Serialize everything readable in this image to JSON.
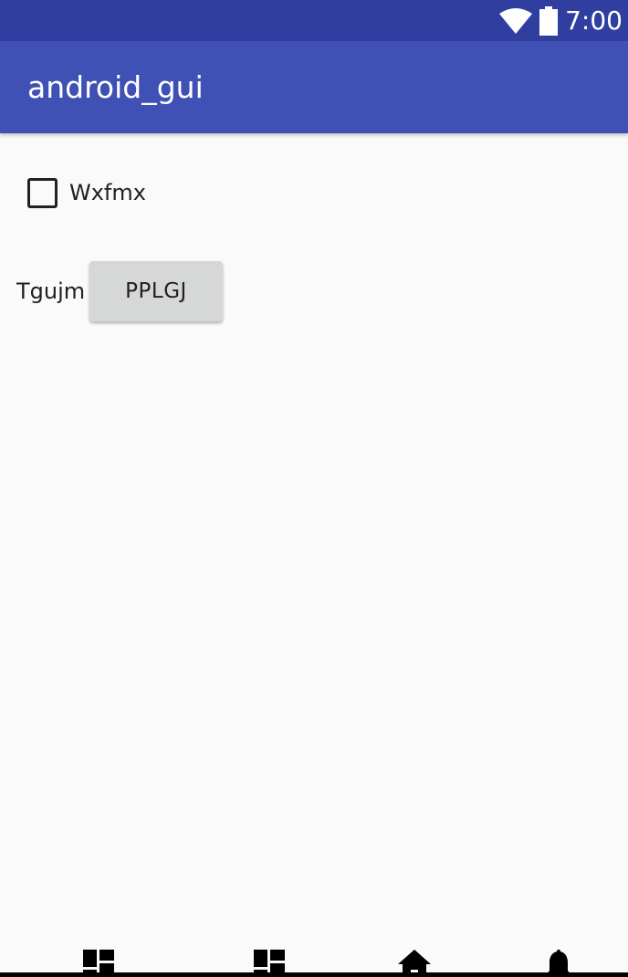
{
  "status_bar": {
    "time": "7:00",
    "icons": [
      "wifi-icon",
      "battery-icon"
    ],
    "color": "#303f9f"
  },
  "app_bar": {
    "title": "android_gui",
    "color": "#3f51b5"
  },
  "content": {
    "checkbox": {
      "label": "Wxfmx",
      "checked": false
    },
    "field_label": "Tgujm",
    "button_label": "PPLGJ"
  },
  "bottom_nav": {
    "items": [
      {
        "icon": "dashboard-icon"
      },
      {
        "icon": "dashboard-icon"
      },
      {
        "icon": "home-icon"
      },
      {
        "icon": "notifications-icon"
      }
    ]
  }
}
